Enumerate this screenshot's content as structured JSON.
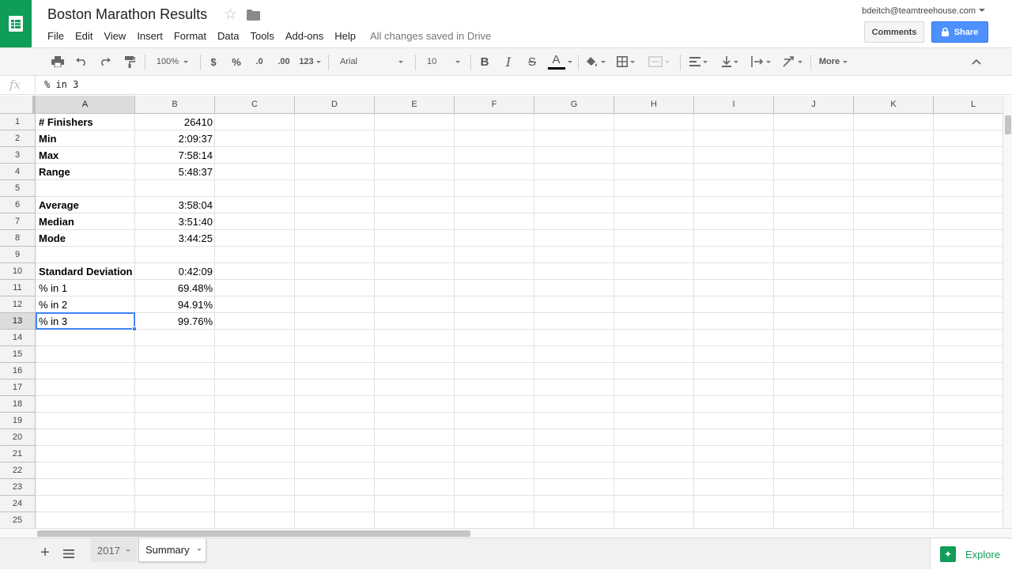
{
  "header": {
    "title": "Boston Marathon Results",
    "save_status": "All changes saved in Drive",
    "user_email": "bdeitch@teamtreehouse.com",
    "comments_label": "Comments",
    "share_label": "Share",
    "menu": [
      "File",
      "Edit",
      "View",
      "Insert",
      "Format",
      "Data",
      "Tools",
      "Add-ons",
      "Help"
    ]
  },
  "toolbar": {
    "zoom": "100%",
    "currency": "$",
    "percent": "%",
    "decrease_decimal": ".0",
    "increase_decimal": ".00",
    "more_formats": "123",
    "font_family": "Arial",
    "font_size": "10",
    "bold": "B",
    "italic": "I",
    "strikethrough": "S",
    "text_color": "A",
    "more_label": "More"
  },
  "formula_bar": {
    "fx": "fx",
    "value": "% in 3"
  },
  "grid": {
    "columns": [
      "A",
      "B",
      "C",
      "D",
      "E",
      "F",
      "G",
      "H",
      "I",
      "J",
      "K",
      "L"
    ],
    "rows": [
      "1",
      "2",
      "3",
      "4",
      "5",
      "6",
      "7",
      "8",
      "9",
      "10",
      "11",
      "12",
      "13",
      "14",
      "15",
      "16",
      "17",
      "18",
      "19",
      "20",
      "21",
      "22",
      "23",
      "24",
      "25"
    ],
    "selected_column": "A",
    "selected_row": "13",
    "cells": [
      {
        "row": 1,
        "label": "# Finishers",
        "value": "26410",
        "bold": true
      },
      {
        "row": 2,
        "label": "Min",
        "value": "2:09:37",
        "bold": true
      },
      {
        "row": 3,
        "label": "Max",
        "value": "7:58:14",
        "bold": true
      },
      {
        "row": 4,
        "label": "Range",
        "value": "5:48:37",
        "bold": true
      },
      {
        "row": 6,
        "label": "Average",
        "value": "3:58:04",
        "bold": true
      },
      {
        "row": 7,
        "label": "Median",
        "value": "3:51:40",
        "bold": true
      },
      {
        "row": 8,
        "label": "Mode",
        "value": "3:44:25",
        "bold": true
      },
      {
        "row": 10,
        "label": "Standard Deviation",
        "value": "0:42:09",
        "bold": true
      },
      {
        "row": 11,
        "label": "% in 1",
        "value": "69.48%",
        "bold": false
      },
      {
        "row": 12,
        "label": "% in 2",
        "value": "94.91%",
        "bold": false
      },
      {
        "row": 13,
        "label": "% in 3",
        "value": "99.76%",
        "bold": false
      }
    ]
  },
  "sheets": {
    "tabs": [
      "2017",
      "Summary"
    ],
    "active": "Summary"
  },
  "explore_label": "Explore",
  "colors": {
    "brand_green": "#0f9d58",
    "share_blue": "#4d90fe",
    "selection_blue": "#4285f4"
  }
}
